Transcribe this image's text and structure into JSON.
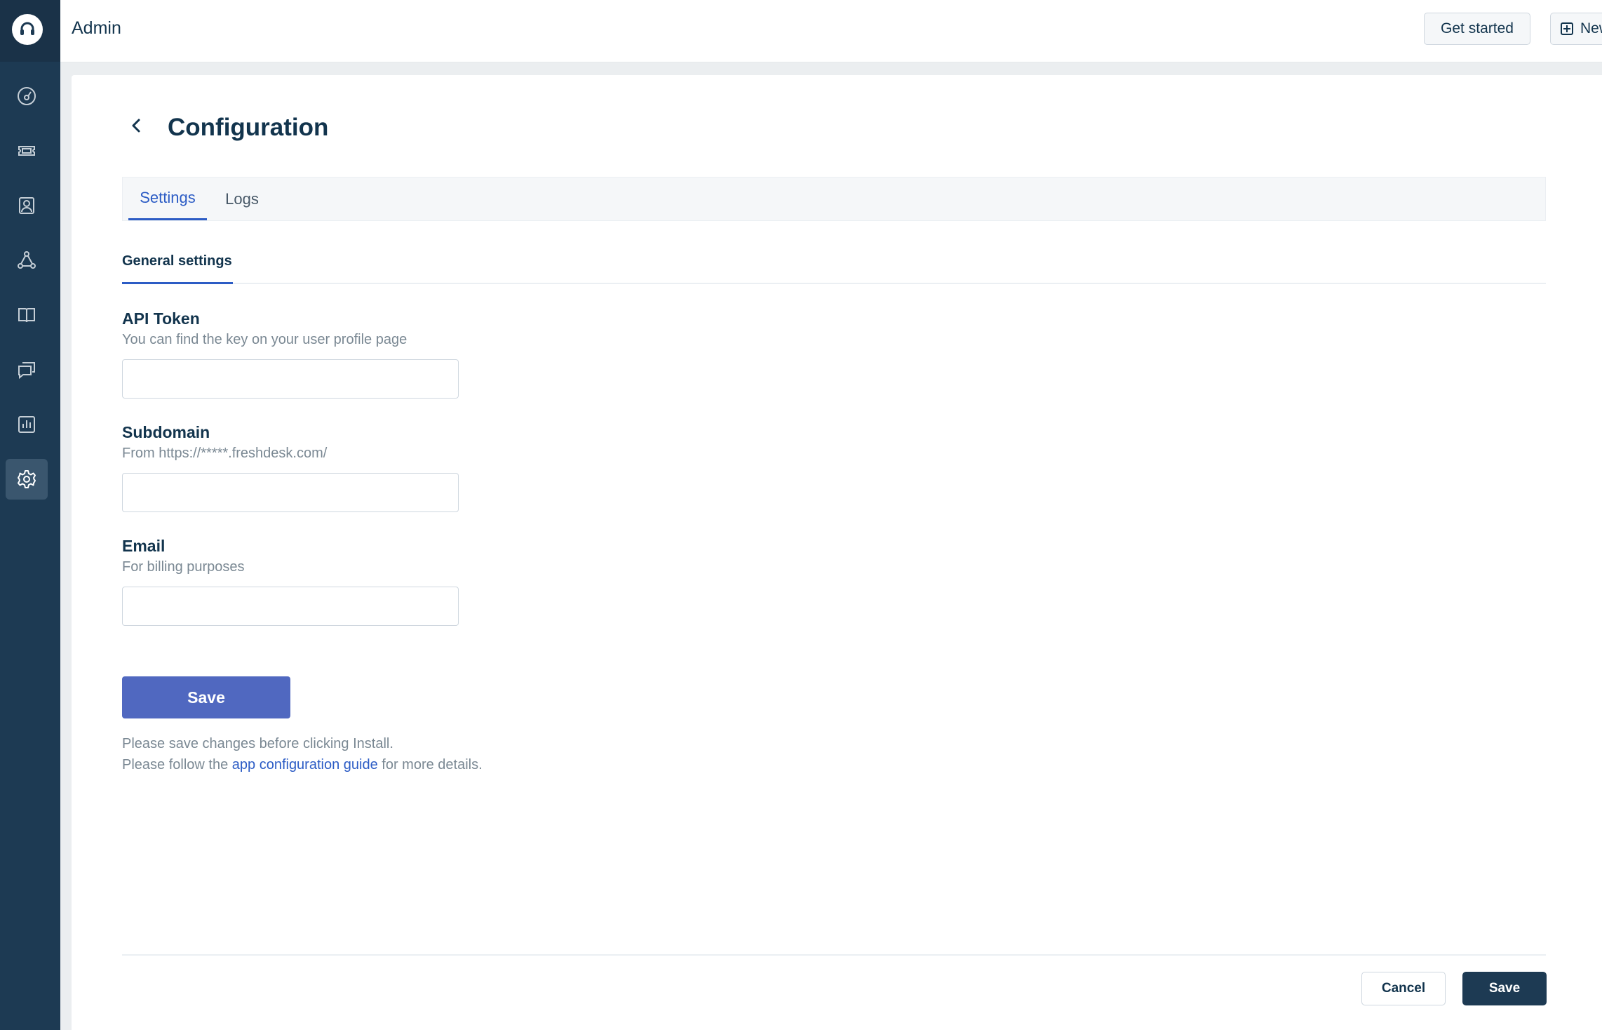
{
  "header": {
    "title": "Admin",
    "get_started_label": "Get started",
    "new_label": "New"
  },
  "sidebar": {
    "items": [
      {
        "icon": "dashboard-icon"
      },
      {
        "icon": "tickets-icon"
      },
      {
        "icon": "contacts-icon"
      },
      {
        "icon": "groups-icon"
      },
      {
        "icon": "solutions-icon"
      },
      {
        "icon": "discussions-icon"
      },
      {
        "icon": "analytics-icon"
      },
      {
        "icon": "gear-icon",
        "active": true
      }
    ]
  },
  "page": {
    "title": "Configuration",
    "tabs": [
      {
        "label": "Settings",
        "active": true
      },
      {
        "label": "Logs",
        "active": false
      }
    ],
    "section_tab": "General settings"
  },
  "form": {
    "api_token": {
      "label": "API Token",
      "hint": "You can find the key on your user profile page",
      "value": ""
    },
    "subdomain": {
      "label": "Subdomain",
      "hint": "From https://*****.freshdesk.com/",
      "value": ""
    },
    "email": {
      "label": "Email",
      "hint": "For billing purposes",
      "value": ""
    },
    "save_label": "Save",
    "note_line1": "Please save changes before clicking Install.",
    "note_line2_prefix": "Please follow the ",
    "note_link": "app configuration guide",
    "note_line2_suffix": " for more details."
  },
  "footer": {
    "cancel_label": "Cancel",
    "save_label": "Save"
  },
  "colors": {
    "sidebar": "#1d3a53",
    "accent": "#2c5cc5",
    "primary_button": "#5068c0",
    "text": "#12344d",
    "muted": "#7a8893"
  }
}
